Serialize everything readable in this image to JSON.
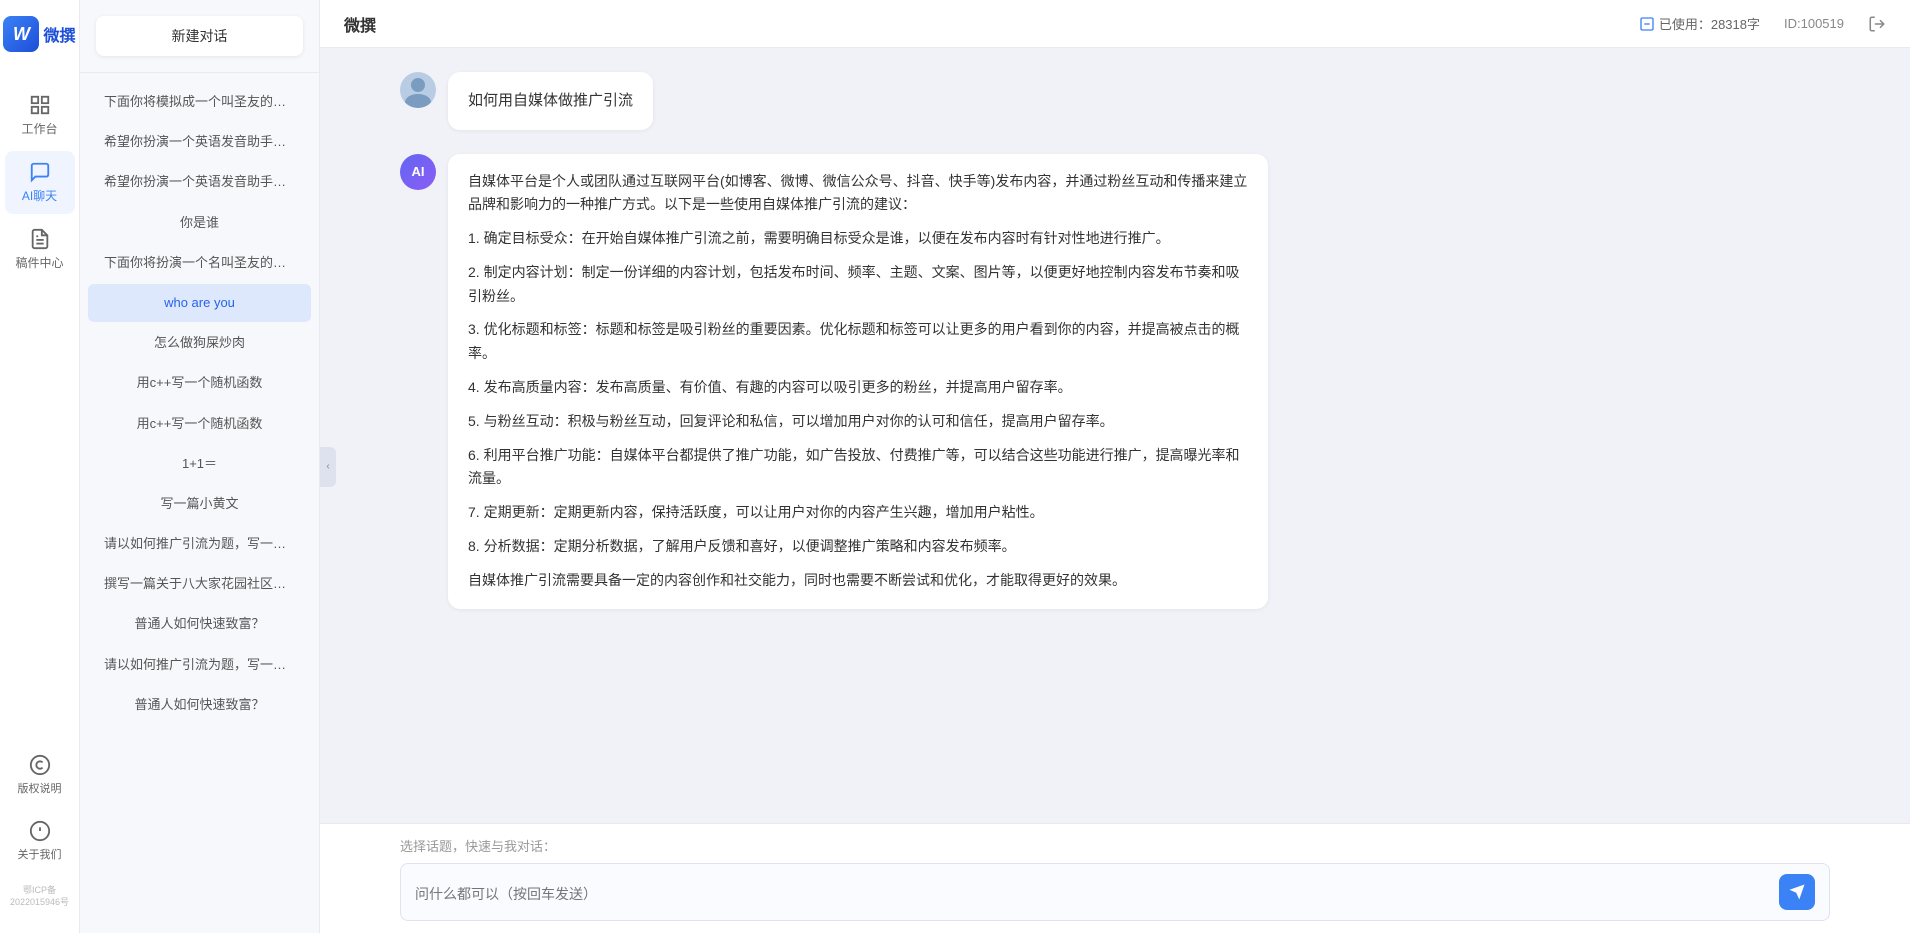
{
  "app": {
    "name": "微撰",
    "logo_letter": "W",
    "title": "微撰"
  },
  "topbar": {
    "title": "微撰",
    "usage_label": "已使用：28318字",
    "usage_icon": "info-icon",
    "id_label": "ID:100519",
    "logout_icon": "logout-icon"
  },
  "nav": {
    "items": [
      {
        "id": "workspace",
        "label": "工作台",
        "icon": "grid-icon"
      },
      {
        "id": "ai-chat",
        "label": "AI聊天",
        "icon": "chat-icon",
        "active": true
      },
      {
        "id": "plugin",
        "label": "稿件中心",
        "icon": "document-icon"
      }
    ],
    "bottom": [
      {
        "id": "copyright",
        "label": "版权说明",
        "icon": "copyright-icon"
      },
      {
        "id": "about",
        "label": "关于我们",
        "icon": "about-icon"
      }
    ],
    "icp": "鄂ICP备2022015946号"
  },
  "sidebar": {
    "new_chat_label": "新建对话",
    "items": [
      {
        "id": 1,
        "text": "下面你将模拟成一个叫圣友的程序员，我说...",
        "active": false
      },
      {
        "id": 2,
        "text": "希望你扮演一个英语发音助手，我提供给你...",
        "active": false
      },
      {
        "id": 3,
        "text": "希望你扮演一个英语发音助手，我提供给你...",
        "active": false
      },
      {
        "id": 4,
        "text": "你是谁",
        "active": false
      },
      {
        "id": 5,
        "text": "下面你将扮演一个名叫圣友的医生",
        "active": false
      },
      {
        "id": 6,
        "text": "who are you",
        "active": true
      },
      {
        "id": 7,
        "text": "怎么做狗屎炒肉",
        "active": false
      },
      {
        "id": 8,
        "text": "用c++写一个随机函数",
        "active": false
      },
      {
        "id": 9,
        "text": "用c++写一个随机函数",
        "active": false
      },
      {
        "id": 10,
        "text": "1+1＝",
        "active": false
      },
      {
        "id": 11,
        "text": "写一篇小黄文",
        "active": false
      },
      {
        "id": 12,
        "text": "请以如何推广引流为题，写一篇大纲",
        "active": false
      },
      {
        "id": 13,
        "text": "撰写一篇关于八大家花园社区一刻钟便民生...",
        "active": false
      },
      {
        "id": 14,
        "text": "普通人如何快速致富？",
        "active": false
      },
      {
        "id": 15,
        "text": "请以如何推广引流为题，写一篇大纲",
        "active": false
      },
      {
        "id": 16,
        "text": "普通人如何快速致富？",
        "active": false
      }
    ]
  },
  "chat": {
    "messages": [
      {
        "id": 1,
        "role": "user",
        "text": "如何用自媒体做推广引流",
        "avatar_type": "user"
      },
      {
        "id": 2,
        "role": "ai",
        "avatar_type": "ai",
        "paragraphs": [
          "自媒体平台是个人或团队通过互联网平台(如博客、微博、微信公众号、抖音、快手等)发布内容，并通过粉丝互动和传播来建立品牌和影响力的一种推广方式。以下是一些使用自媒体推广引流的建议：",
          "1. 确定目标受众：在开始自媒体推广引流之前，需要明确目标受众是谁，以便在发布内容时有针对性地进行推广。",
          "2. 制定内容计划：制定一份详细的内容计划，包括发布时间、频率、主题、文案、图片等，以便更好地控制内容发布节奏和吸引粉丝。",
          "3. 优化标题和标签：标题和标签是吸引粉丝的重要因素。优化标题和标签可以让更多的用户看到你的内容，并提高被点击的概率。",
          "4. 发布高质量内容：发布高质量、有价值、有趣的内容可以吸引更多的粉丝，并提高用户留存率。",
          "5. 与粉丝互动：积极与粉丝互动，回复评论和私信，可以增加用户对你的认可和信任，提高用户留存率。",
          "6. 利用平台推广功能：自媒体平台都提供了推广功能，如广告投放、付费推广等，可以结合这些功能进行推广，提高曝光率和流量。",
          "7. 定期更新：定期更新内容，保持活跃度，可以让用户对你的内容产生兴趣，增加用户粘性。",
          "8. 分析数据：定期分析数据，了解用户反馈和喜好，以便调整推广策略和内容发布频率。",
          "自媒体推广引流需要具备一定的内容创作和社交能力，同时也需要不断尝试和优化，才能取得更好的效果。"
        ]
      }
    ]
  },
  "input": {
    "hint": "选择话题，快速与我对话：",
    "placeholder": "问什么都可以（按回车发送）",
    "send_icon": "send-icon"
  }
}
